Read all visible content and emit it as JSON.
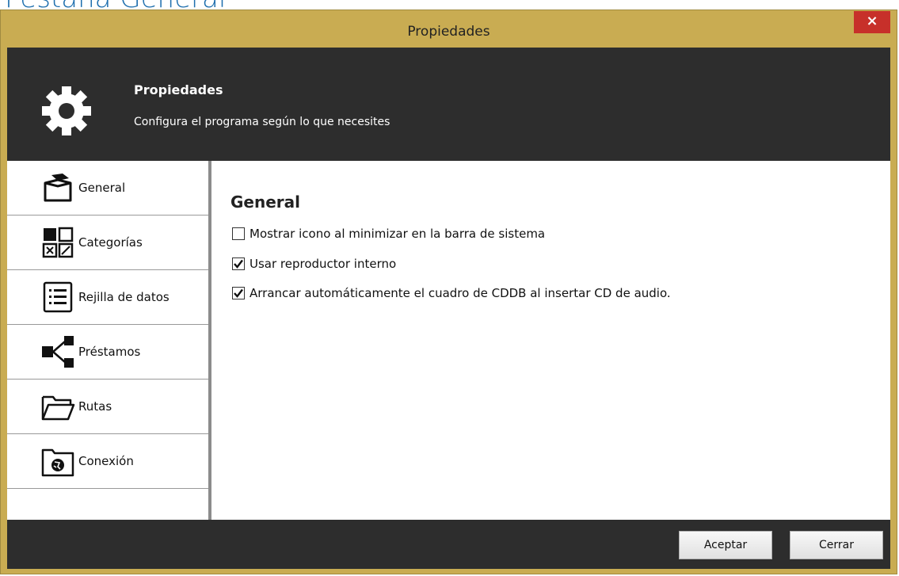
{
  "page_heading": "Pestaña General",
  "window": {
    "title": "Propiedades",
    "close_glyph": "×"
  },
  "banner": {
    "icon": "gear-icon",
    "title": "Propiedades",
    "subtitle": "Configura el programa según lo que necesites"
  },
  "sidebar": {
    "items": [
      {
        "label": "General",
        "icon": "box-icon"
      },
      {
        "label": "Categorías",
        "icon": "categories-icon"
      },
      {
        "label": "Rejilla de datos",
        "icon": "list-icon"
      },
      {
        "label": "Préstamos",
        "icon": "share-icon"
      },
      {
        "label": "Rutas",
        "icon": "folder-icon"
      },
      {
        "label": "Conexión",
        "icon": "globe-folder-icon"
      }
    ]
  },
  "content": {
    "title": "General",
    "options": [
      {
        "label": "Mostrar icono al minimizar en la barra de sistema",
        "checked": false
      },
      {
        "label": "Usar reproductor interno",
        "checked": true
      },
      {
        "label": "Arrancar automáticamente el cuadro de CDDB al insertar CD de audio.",
        "checked": true
      }
    ]
  },
  "footer": {
    "accept_label": "Aceptar",
    "close_label": "Cerrar"
  }
}
